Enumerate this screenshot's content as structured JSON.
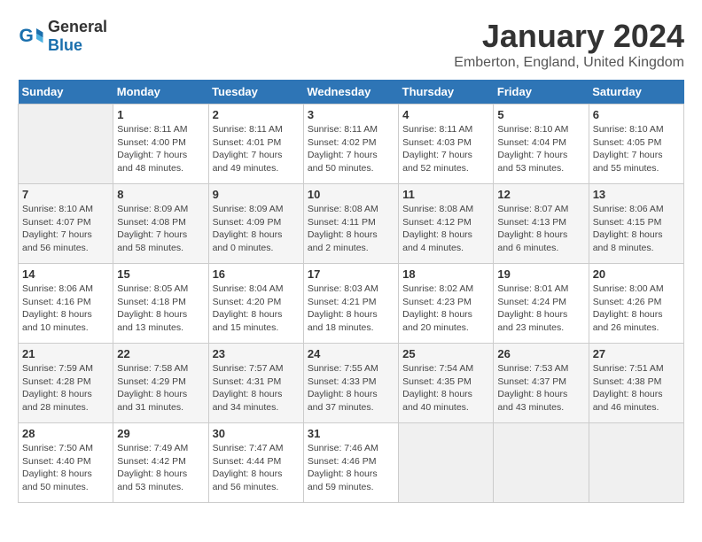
{
  "header": {
    "logo_general": "General",
    "logo_blue": "Blue",
    "title": "January 2024",
    "subtitle": "Emberton, England, United Kingdom"
  },
  "weekdays": [
    "Sunday",
    "Monday",
    "Tuesday",
    "Wednesday",
    "Thursday",
    "Friday",
    "Saturday"
  ],
  "weeks": [
    [
      {
        "day": null
      },
      {
        "day": 1,
        "sunrise": "8:11 AM",
        "sunset": "4:00 PM",
        "daylight": "7 hours and 48 minutes."
      },
      {
        "day": 2,
        "sunrise": "8:11 AM",
        "sunset": "4:01 PM",
        "daylight": "7 hours and 49 minutes."
      },
      {
        "day": 3,
        "sunrise": "8:11 AM",
        "sunset": "4:02 PM",
        "daylight": "7 hours and 50 minutes."
      },
      {
        "day": 4,
        "sunrise": "8:11 AM",
        "sunset": "4:03 PM",
        "daylight": "7 hours and 52 minutes."
      },
      {
        "day": 5,
        "sunrise": "8:10 AM",
        "sunset": "4:04 PM",
        "daylight": "7 hours and 53 minutes."
      },
      {
        "day": 6,
        "sunrise": "8:10 AM",
        "sunset": "4:05 PM",
        "daylight": "7 hours and 55 minutes."
      }
    ],
    [
      {
        "day": 7,
        "sunrise": "8:10 AM",
        "sunset": "4:07 PM",
        "daylight": "7 hours and 56 minutes."
      },
      {
        "day": 8,
        "sunrise": "8:09 AM",
        "sunset": "4:08 PM",
        "daylight": "7 hours and 58 minutes."
      },
      {
        "day": 9,
        "sunrise": "8:09 AM",
        "sunset": "4:09 PM",
        "daylight": "8 hours and 0 minutes."
      },
      {
        "day": 10,
        "sunrise": "8:08 AM",
        "sunset": "4:11 PM",
        "daylight": "8 hours and 2 minutes."
      },
      {
        "day": 11,
        "sunrise": "8:08 AM",
        "sunset": "4:12 PM",
        "daylight": "8 hours and 4 minutes."
      },
      {
        "day": 12,
        "sunrise": "8:07 AM",
        "sunset": "4:13 PM",
        "daylight": "8 hours and 6 minutes."
      },
      {
        "day": 13,
        "sunrise": "8:06 AM",
        "sunset": "4:15 PM",
        "daylight": "8 hours and 8 minutes."
      }
    ],
    [
      {
        "day": 14,
        "sunrise": "8:06 AM",
        "sunset": "4:16 PM",
        "daylight": "8 hours and 10 minutes."
      },
      {
        "day": 15,
        "sunrise": "8:05 AM",
        "sunset": "4:18 PM",
        "daylight": "8 hours and 13 minutes."
      },
      {
        "day": 16,
        "sunrise": "8:04 AM",
        "sunset": "4:20 PM",
        "daylight": "8 hours and 15 minutes."
      },
      {
        "day": 17,
        "sunrise": "8:03 AM",
        "sunset": "4:21 PM",
        "daylight": "8 hours and 18 minutes."
      },
      {
        "day": 18,
        "sunrise": "8:02 AM",
        "sunset": "4:23 PM",
        "daylight": "8 hours and 20 minutes."
      },
      {
        "day": 19,
        "sunrise": "8:01 AM",
        "sunset": "4:24 PM",
        "daylight": "8 hours and 23 minutes."
      },
      {
        "day": 20,
        "sunrise": "8:00 AM",
        "sunset": "4:26 PM",
        "daylight": "8 hours and 26 minutes."
      }
    ],
    [
      {
        "day": 21,
        "sunrise": "7:59 AM",
        "sunset": "4:28 PM",
        "daylight": "8 hours and 28 minutes."
      },
      {
        "day": 22,
        "sunrise": "7:58 AM",
        "sunset": "4:29 PM",
        "daylight": "8 hours and 31 minutes."
      },
      {
        "day": 23,
        "sunrise": "7:57 AM",
        "sunset": "4:31 PM",
        "daylight": "8 hours and 34 minutes."
      },
      {
        "day": 24,
        "sunrise": "7:55 AM",
        "sunset": "4:33 PM",
        "daylight": "8 hours and 37 minutes."
      },
      {
        "day": 25,
        "sunrise": "7:54 AM",
        "sunset": "4:35 PM",
        "daylight": "8 hours and 40 minutes."
      },
      {
        "day": 26,
        "sunrise": "7:53 AM",
        "sunset": "4:37 PM",
        "daylight": "8 hours and 43 minutes."
      },
      {
        "day": 27,
        "sunrise": "7:51 AM",
        "sunset": "4:38 PM",
        "daylight": "8 hours and 46 minutes."
      }
    ],
    [
      {
        "day": 28,
        "sunrise": "7:50 AM",
        "sunset": "4:40 PM",
        "daylight": "8 hours and 50 minutes."
      },
      {
        "day": 29,
        "sunrise": "7:49 AM",
        "sunset": "4:42 PM",
        "daylight": "8 hours and 53 minutes."
      },
      {
        "day": 30,
        "sunrise": "7:47 AM",
        "sunset": "4:44 PM",
        "daylight": "8 hours and 56 minutes."
      },
      {
        "day": 31,
        "sunrise": "7:46 AM",
        "sunset": "4:46 PM",
        "daylight": "8 hours and 59 minutes."
      },
      {
        "day": null
      },
      {
        "day": null
      },
      {
        "day": null
      }
    ]
  ]
}
